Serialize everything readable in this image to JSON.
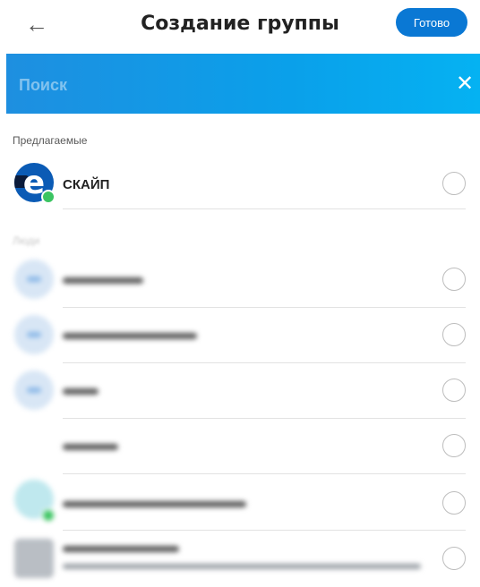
{
  "header": {
    "back_icon": "←",
    "title": "Создание группы",
    "done_label": "Готово"
  },
  "search": {
    "placeholder": "Поиск",
    "close_icon": "✕"
  },
  "sections": {
    "suggested_label": "Предлагаемые",
    "people_label": "Люди"
  },
  "suggested": [
    {
      "name": "СКАЙП",
      "online": true
    }
  ],
  "colors": {
    "accent": "#0a78d4",
    "online": "#3bc462"
  }
}
